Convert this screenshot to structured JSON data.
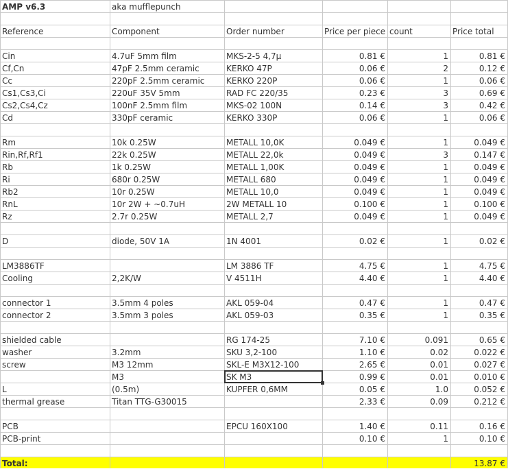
{
  "title_row": {
    "left": "AMP v6.3",
    "right": "aka mufflepunch"
  },
  "columns": [
    "Reference",
    "Component",
    "Order number",
    "Price per piece",
    "count",
    "Price total"
  ],
  "rows": [
    [
      "",
      "",
      "",
      "",
      "",
      ""
    ],
    [
      "Cin",
      "4.7uF 5mm film",
      "MKS-2-5 4,7µ",
      "0.81 €",
      "1",
      "0.81 €"
    ],
    [
      "Cf,Cn",
      "47pF 2.5mm ceramic",
      "KERKO 47P",
      "0.06 €",
      "2",
      "0.12 €"
    ],
    [
      "Cc",
      "220pF 2.5mm ceramic",
      "KERKO 220P",
      "0.06 €",
      "1",
      "0.06 €"
    ],
    [
      "Cs1,Cs3,Ci",
      "220uF 35V 5mm",
      "RAD FC 220/35",
      "0.23 €",
      "3",
      "0.69 €"
    ],
    [
      "Cs2,Cs4,Cz",
      "100nF 2.5mm film",
      "MKS-02 100N",
      "0.14 €",
      "3",
      "0.42 €"
    ],
    [
      "Cd",
      "330pF ceramic",
      "KERKO 330P",
      "0.06 €",
      "1",
      "0.06 €"
    ],
    [
      "",
      "",
      "",
      "",
      "",
      ""
    ],
    [
      "Rm",
      "10k 0.25W",
      "METALL 10,0K",
      "0.049 €",
      "1",
      "0.049 €"
    ],
    [
      "Rin,Rf,Rf1",
      "22k 0.25W",
      "METALL 22,0k",
      "0.049 €",
      "3",
      "0.147 €"
    ],
    [
      "Rb",
      "1k 0.25W",
      "METALL 1,00K",
      "0.049 €",
      "1",
      "0.049 €"
    ],
    [
      "Ri",
      "680r 0.25W",
      "METALL 680",
      "0.049 €",
      "1",
      "0.049 €"
    ],
    [
      "Rb2",
      "10r 0.25W",
      "METALL 10,0",
      "0.049 €",
      "1",
      "0.049 €"
    ],
    [
      "RnL",
      "10r 2W + ~0.7uH",
      "2W METALL 10",
      "0.100 €",
      "1",
      "0.100 €"
    ],
    [
      "Rz",
      "2.7r 0.25W",
      "METALL 2,7",
      "0.049 €",
      "1",
      "0.049 €"
    ],
    [
      "",
      "",
      "",
      "",
      "",
      ""
    ],
    [
      "D",
      "diode, 50V 1A",
      "1N 4001",
      "0.02 €",
      "1",
      "0.02 €"
    ],
    [
      "",
      "",
      "",
      "",
      "",
      ""
    ],
    [
      "LM3886TF",
      "",
      "LM 3886 TF",
      "4.75 €",
      "1",
      "4.75 €"
    ],
    [
      "Cooling",
      "2,2K/W",
      "V 4511H",
      "4.40 €",
      "1",
      "4.40 €"
    ],
    [
      "",
      "",
      "",
      "",
      "",
      ""
    ],
    [
      "connector 1",
      "3.5mm 4 poles",
      "AKL 059-04",
      "0.47 €",
      "1",
      "0.47 €"
    ],
    [
      "connector 2",
      "3.5mm 3 poles",
      "AKL 059-03",
      "0.35 €",
      "1",
      "0.35 €"
    ],
    [
      "",
      "",
      "",
      "",
      "",
      ""
    ],
    [
      "shielded cable",
      "",
      "RG 174-25",
      "7.10 €",
      "0.091",
      "0.65 €"
    ],
    [
      "washer",
      "3.2mm",
      "SKU 3,2-100",
      "1.10 €",
      "0.02",
      "0.022 €"
    ],
    [
      "screw",
      "M3 12mm",
      "SKL-E M3X12-100",
      "2.65 €",
      "0.01",
      "0.027 €"
    ],
    [
      "",
      "M3",
      "SK M3",
      "0.99 €",
      "0.01",
      "0.010 €"
    ],
    [
      "L",
      "(0.5m)",
      "KUPFER 0,6MM",
      "0.05 €",
      "1.0",
      "0.052 €"
    ],
    [
      "thermal grease",
      "Titan TTG-G30015",
      "",
      "2.33 €",
      "0.09",
      "0.212 €"
    ],
    [
      "",
      "",
      "",
      "",
      "",
      ""
    ],
    [
      "PCB",
      "",
      "EPCU 160X100",
      "1.40 €",
      "0.11",
      "0.16 €"
    ],
    [
      "PCB-print",
      "",
      "",
      "0.10 €",
      "1",
      "0.10 €"
    ],
    [
      "",
      "",
      "",
      "",
      "",
      ""
    ]
  ],
  "total": {
    "label": "Total:",
    "value": "13.87 €",
    "highlight_color": "#ffff00"
  },
  "selected_cell": {
    "row_index": 27,
    "column_index": 2,
    "value": "SK M3"
  }
}
